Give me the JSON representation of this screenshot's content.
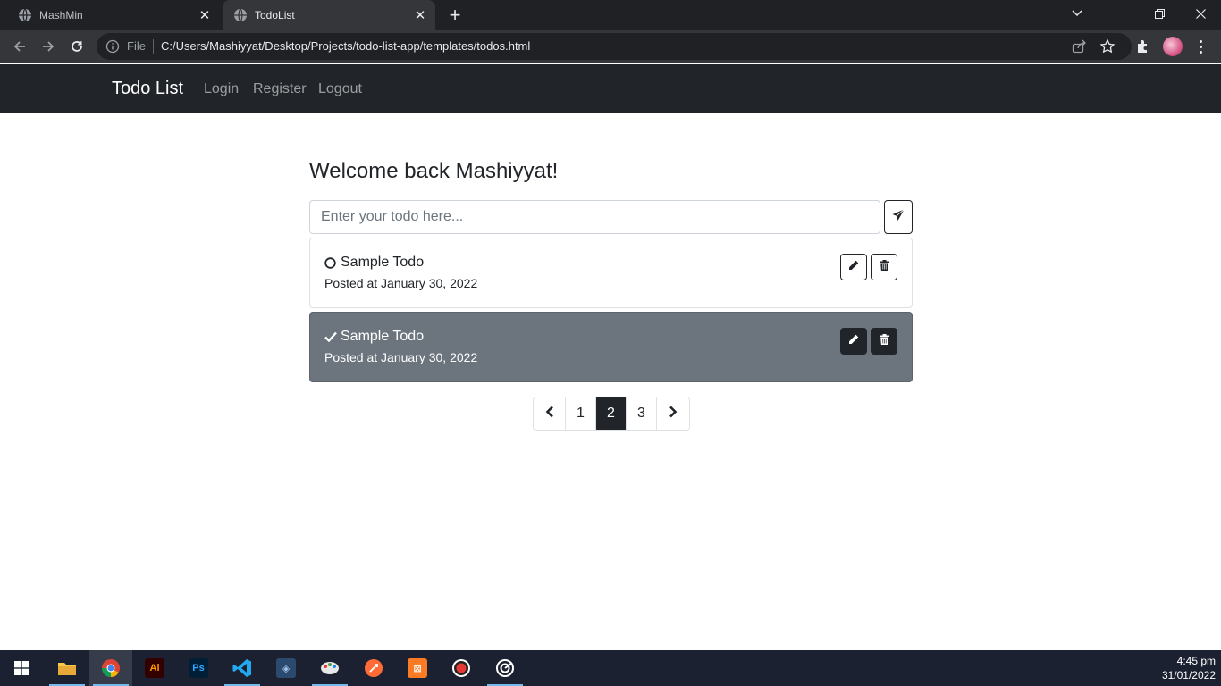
{
  "browser": {
    "tabs": [
      {
        "title": "MashMin",
        "active": false
      },
      {
        "title": "TodoList",
        "active": true
      }
    ],
    "omnibox": {
      "scheme_label": "File",
      "url": "C:/Users/Mashiyyat/Desktop/Projects/todo-list-app/templates/todos.html"
    }
  },
  "navbar": {
    "brand": "Todo List",
    "links": [
      "Login",
      "Register",
      "Logout"
    ]
  },
  "main": {
    "welcome": "Welcome back Mashiyyat!",
    "input_placeholder": "Enter your todo here...",
    "todos": [
      {
        "title": "Sample Todo",
        "date": "Posted at January 30, 2022",
        "completed": false
      },
      {
        "title": "Sample Todo",
        "date": "Posted at January 30, 2022",
        "completed": true
      }
    ],
    "pagination": {
      "pages": [
        "1",
        "2",
        "3"
      ],
      "active_page": "2"
    }
  },
  "taskbar": {
    "apps": [
      "windows-start",
      "file-explorer",
      "chrome",
      "illustrator",
      "photoshop",
      "vscode",
      "mysql-workbench",
      "paint",
      "postman",
      "xampp",
      "obs",
      "resolve"
    ],
    "time": "4:45 pm",
    "date": "31/01/2022"
  },
  "colors": {
    "navbar_bg": "#212529",
    "completed_card_bg": "#6c757d",
    "browser_frame": "#202124"
  }
}
